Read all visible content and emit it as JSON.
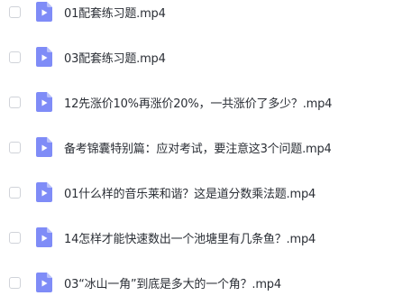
{
  "files": [
    {
      "name": "01配套练习题.mp4",
      "icon": "video-file-icon"
    },
    {
      "name": "03配套练习题.mp4",
      "icon": "video-file-icon"
    },
    {
      "name": "12先涨价10%再涨价20%，一共涨价了多少？.mp4",
      "icon": "video-file-icon"
    },
    {
      "name": "备考锦囊特别篇：应对考试，要注意这3个问题.mp4",
      "icon": "video-file-icon"
    },
    {
      "name": "01什么样的音乐莱和谐？这是道分数乘法题.mp4",
      "icon": "video-file-icon"
    },
    {
      "name": "14怎样才能快速数出一个池塘里有几条鱼？.mp4",
      "icon": "video-file-icon"
    },
    {
      "name": "03“冰山一角”到底是多大的一个角？.mp4",
      "icon": "video-file-icon"
    }
  ],
  "colors": {
    "icon_fill": "#7f8cf7",
    "icon_fold": "#b9c1fb",
    "text": "#2b2f36",
    "checkbox_border": "#d0d3d9"
  }
}
